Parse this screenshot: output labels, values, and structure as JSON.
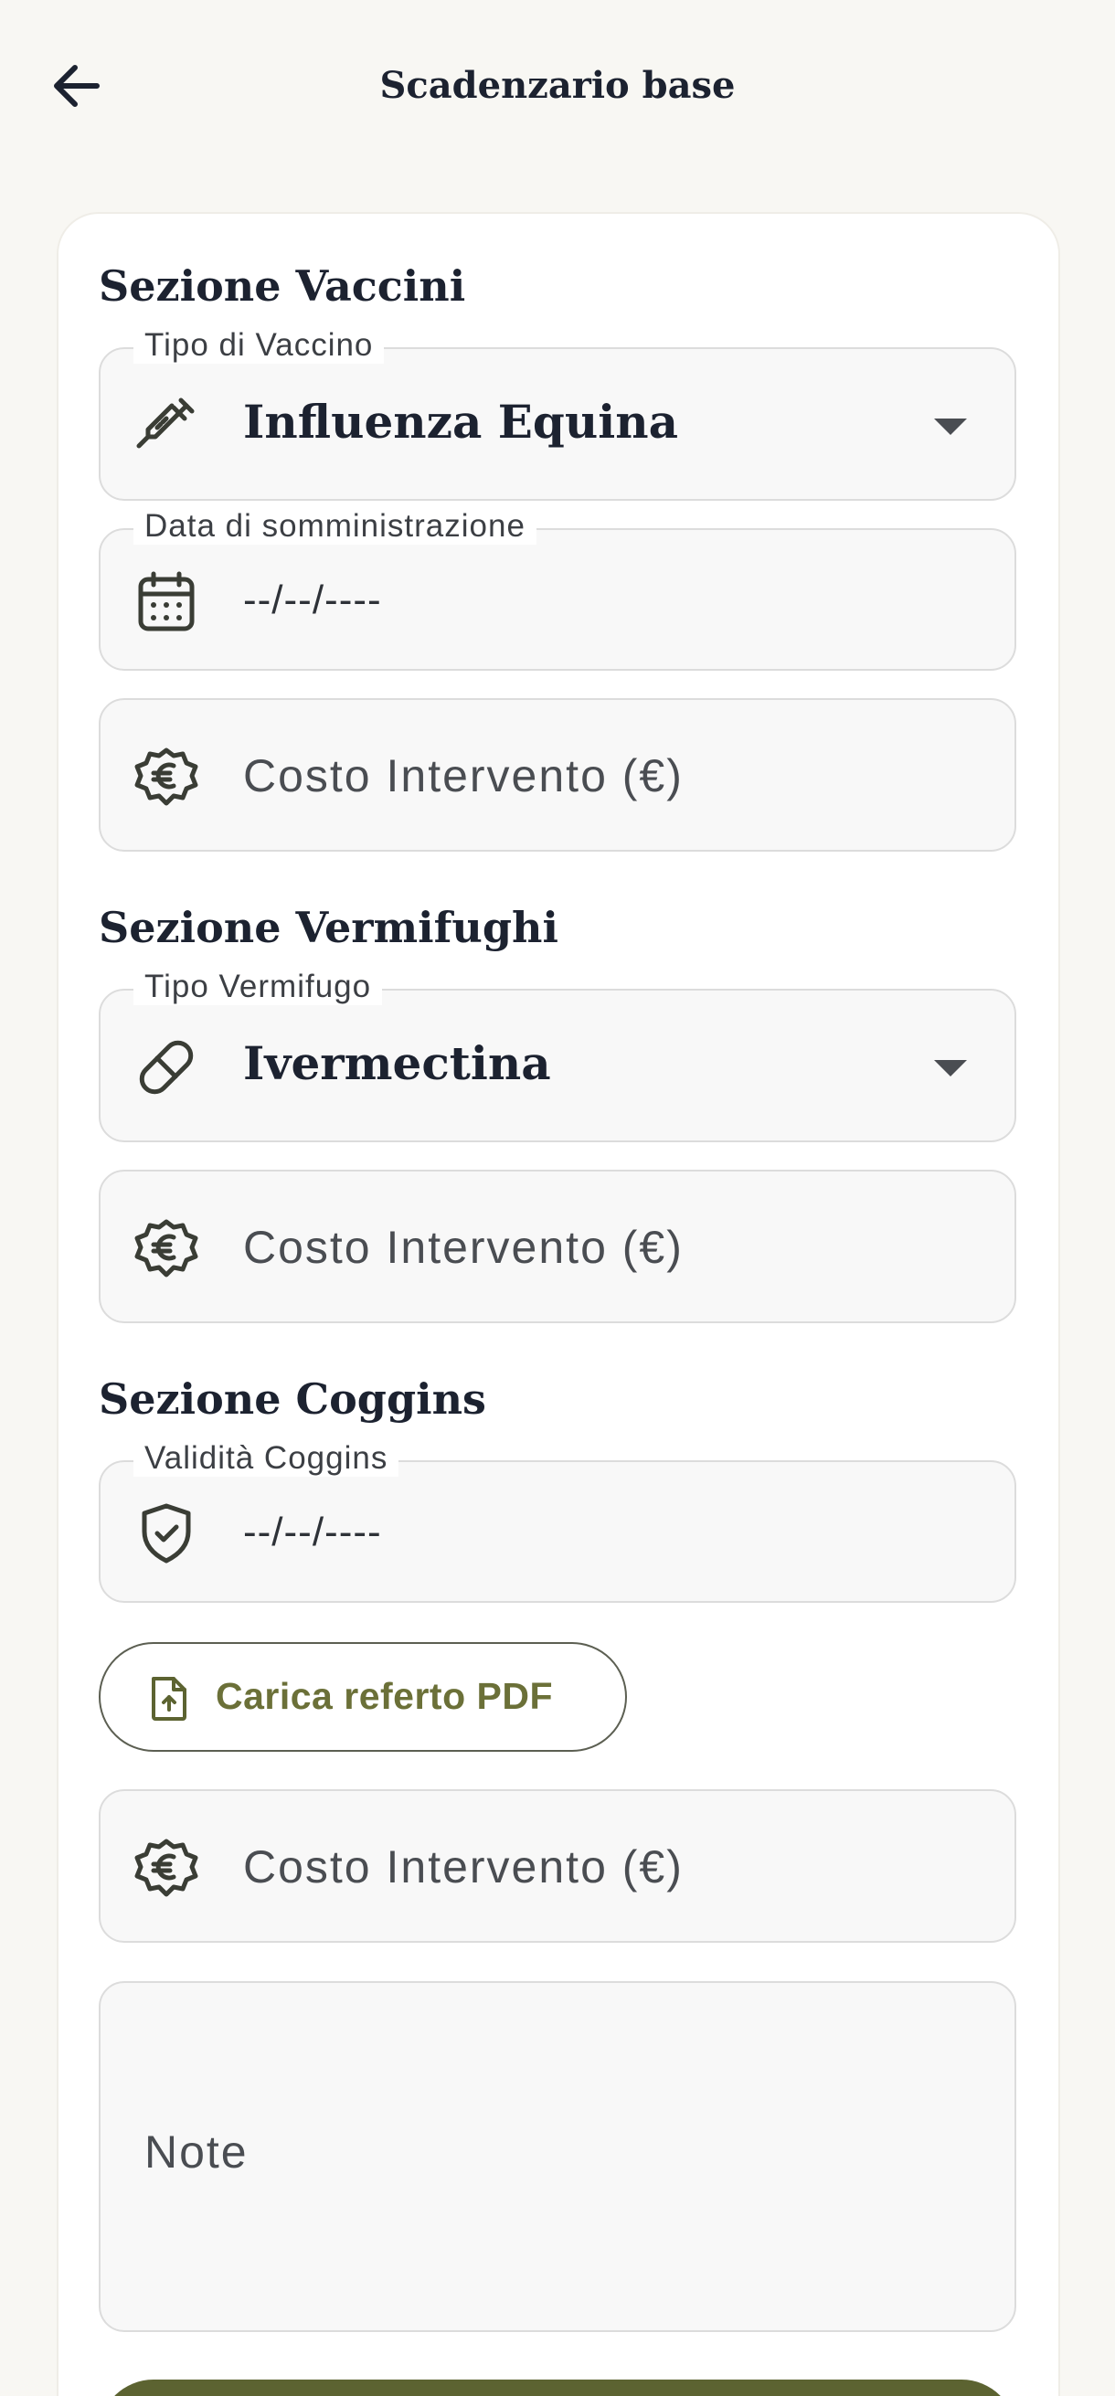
{
  "header": {
    "title": "Scadenzario base",
    "back_icon": "arrow-left-icon"
  },
  "vaccini": {
    "title": "Sezione Vaccini",
    "tipo_label": "Tipo di Vaccino",
    "tipo_value": "Influenza Equina",
    "tipo_icon": "syringe-icon",
    "data_label": "Data di somministrazione",
    "data_value": "--/--/----",
    "data_icon": "calendar-icon",
    "costo_placeholder": "Costo Intervento (€)",
    "costo_icon": "euro-icon"
  },
  "vermifughi": {
    "title": "Sezione Vermifughi",
    "tipo_label": "Tipo Vermifugo",
    "tipo_value": "Ivermectina",
    "tipo_icon": "pill-icon",
    "costo_placeholder": "Costo Intervento (€)",
    "costo_icon": "euro-icon"
  },
  "coggins": {
    "title": "Sezione Coggins",
    "validita_label": "Validità Coggins",
    "validita_value": "--/--/----",
    "validita_icon": "shield-check-icon",
    "upload_label": "Carica referto PDF",
    "upload_icon": "file-upload-icon",
    "costo_placeholder": "Costo Intervento (€)",
    "costo_icon": "euro-icon"
  },
  "notes": {
    "placeholder": "Note"
  },
  "colors": {
    "background": "#f8f7f3",
    "card": "#ffffff",
    "text": "#1c2230",
    "accent": "#5c6331",
    "accent_text": "#6b7038"
  }
}
